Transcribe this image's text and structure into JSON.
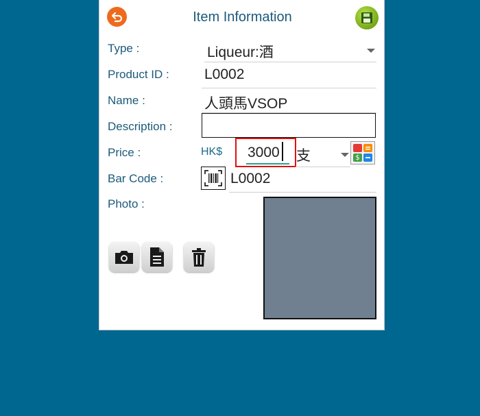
{
  "header": {
    "title": "Item Information",
    "back_icon": "back-arrow-icon",
    "save_icon": "save-floppy-icon"
  },
  "form": {
    "type": {
      "label": "Type :",
      "value": "Liqueur:酒"
    },
    "product_id": {
      "label": "Product ID :",
      "value": "L0002"
    },
    "name": {
      "label": "Name :",
      "value": "人頭馬VSOP"
    },
    "description": {
      "label": "Description :",
      "value": ""
    },
    "price": {
      "label": "Price :",
      "currency": "HK$",
      "value": "3000",
      "unit": "支"
    },
    "bar_code": {
      "label": "Bar Code :",
      "value": "L0002"
    },
    "photo": {
      "label": "Photo :"
    }
  },
  "colors": {
    "background": "#006790",
    "label": "#1b5a7a",
    "highlight": "#e01010",
    "photo_placeholder": "#708090"
  }
}
